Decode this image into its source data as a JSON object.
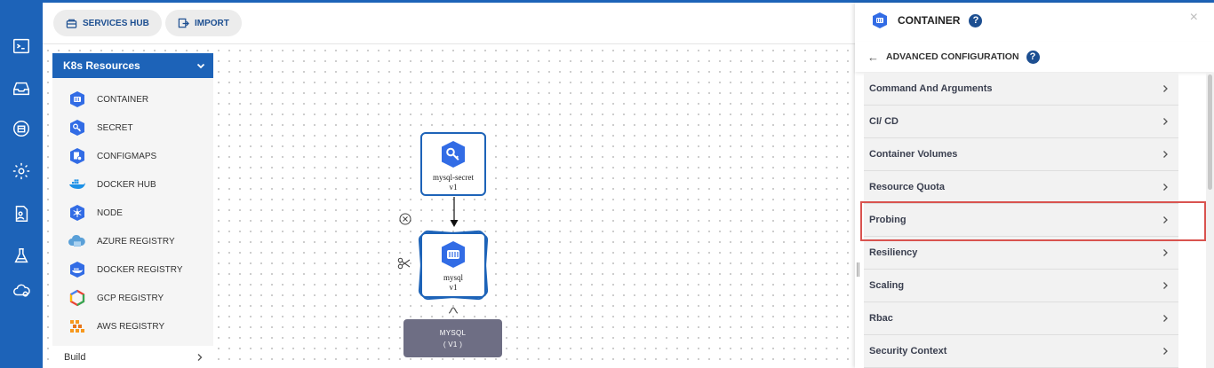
{
  "toolbar": {
    "services_hub_label": "SERVICES HUB",
    "import_label": "IMPORT"
  },
  "resources": {
    "title": "K8s Resources",
    "items": [
      {
        "label": "CONTAINER",
        "icon": "container-icon"
      },
      {
        "label": "SECRET",
        "icon": "key-icon"
      },
      {
        "label": "CONFIGMAPS",
        "icon": "configmap-icon"
      },
      {
        "label": "DOCKER HUB",
        "icon": "docker-icon"
      },
      {
        "label": "NODE",
        "icon": "node-icon"
      },
      {
        "label": "AZURE REGISTRY",
        "icon": "azure-icon"
      },
      {
        "label": "DOCKER REGISTRY",
        "icon": "docker-registry-icon"
      },
      {
        "label": "GCP REGISTRY",
        "icon": "gcp-icon"
      },
      {
        "label": "AWS REGISTRY",
        "icon": "aws-icon"
      }
    ],
    "build_label": "Build"
  },
  "canvas": {
    "secret_node": {
      "name": "mysql-secret",
      "version": "v1"
    },
    "container_node": {
      "name": "mysql",
      "version": "v1"
    },
    "service_box": {
      "name": "MYSQL",
      "version": "( V1 )"
    }
  },
  "panel": {
    "title": "CONTAINER",
    "help": "?",
    "close": "×",
    "advanced_label": "ADVANCED CONFIGURATION",
    "rows": [
      "Command And Arguments",
      "CI/ CD",
      "Container Volumes",
      "Resource Quota",
      "Probing",
      "Resiliency",
      "Scaling",
      "Rbac",
      "Security Context"
    ],
    "highlighted_row": "Probing"
  },
  "colors": {
    "brand_blue": "#1d63b8",
    "highlight_red": "#d9534f",
    "service_grey": "#6e6e84"
  }
}
